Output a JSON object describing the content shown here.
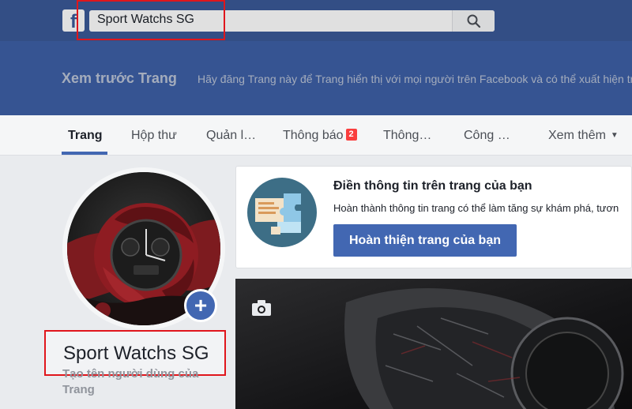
{
  "header": {
    "logo_text": "f",
    "search": {
      "value": "Sport Watchs SG"
    }
  },
  "preview": {
    "title": "Xem trước Trang",
    "text": "Hãy đăng Trang này để Trang hiển thị với mọi người trên Facebook và có thể xuất hiện tro"
  },
  "tabs": [
    {
      "label": "Trang"
    },
    {
      "label": "Hộp thư"
    },
    {
      "label": "Quản l…"
    },
    {
      "label": "Thông báo",
      "badge": "2"
    },
    {
      "label": "Thông…"
    },
    {
      "label": "Công …"
    },
    {
      "label": "Xem thêm"
    }
  ],
  "profile": {
    "page_name": "Sport Watchs SG",
    "username_hint": "Tạo tên người dùng của Trang"
  },
  "info_card": {
    "title": "Điền thông tin trên trang của bạn",
    "description": "Hoàn thành thông tin trang có thể làm tăng sự khám phá, tươn",
    "button_label": "Hoàn thiện trang của bạn"
  },
  "colors": {
    "facebook_blue": "#3b5998",
    "button_blue": "#4267b2",
    "highlight_red": "#e0161c",
    "badge_red": "#fa3e3e"
  },
  "icons": [
    "facebook-logo-icon",
    "search-icon",
    "add-photo-icon",
    "camera-icon",
    "caret-down-icon"
  ]
}
